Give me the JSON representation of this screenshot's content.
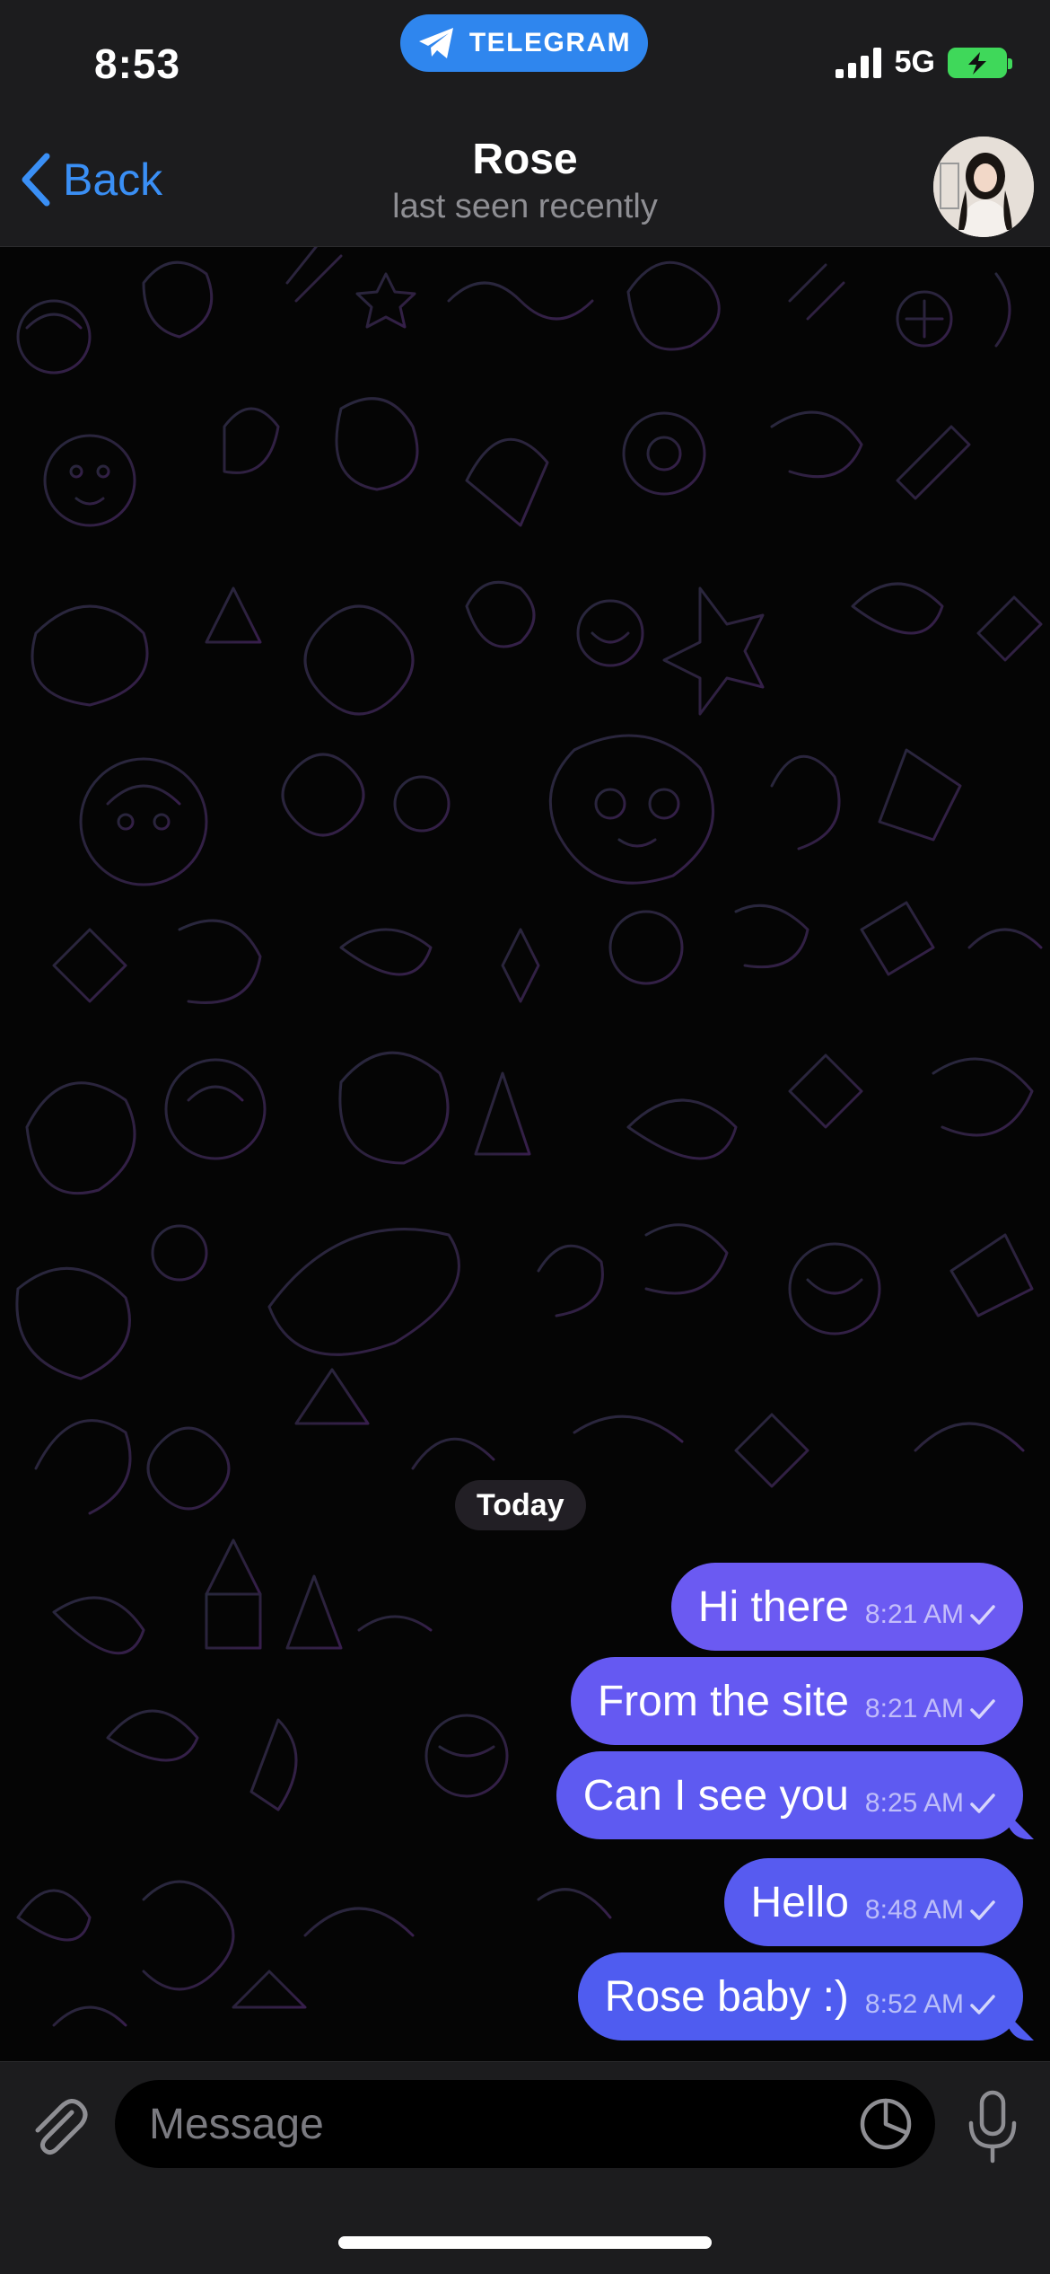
{
  "status_bar": {
    "time": "8:53",
    "app_pill": "TELEGRAM",
    "network": "5G",
    "icons": [
      "signal-icon",
      "battery-charging-icon"
    ]
  },
  "nav": {
    "back_label": "Back",
    "title": "Rose",
    "subtitle": "last seen recently"
  },
  "chat": {
    "date_label": "Today",
    "messages": [
      {
        "text": "Hi there",
        "time": "8:21 AM",
        "status": "sent"
      },
      {
        "text": "From the site",
        "time": "8:21 AM",
        "status": "sent"
      },
      {
        "text": "Can I see you",
        "time": "8:25 AM",
        "status": "sent"
      },
      {
        "text": "Hello",
        "time": "8:48 AM",
        "status": "sent"
      },
      {
        "text": "Rose baby :)",
        "time": "8:52 AM",
        "status": "sent"
      }
    ]
  },
  "composer": {
    "placeholder": "Message"
  },
  "colors": {
    "accent": "#3a8ff5",
    "bubble_top": "#6f5cf3",
    "bubble_bottom": "#4c5cf0",
    "bar_bg": "#1c1c1e",
    "battery": "#3fd85a"
  }
}
